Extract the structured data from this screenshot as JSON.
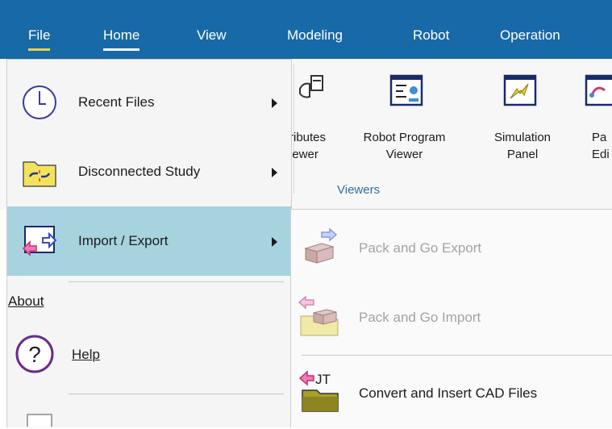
{
  "tabs": [
    {
      "label": "File"
    },
    {
      "label": "Home"
    },
    {
      "label": "View"
    },
    {
      "label": "Modeling"
    },
    {
      "label": "Robot"
    },
    {
      "label": "Operation"
    }
  ],
  "ribbon": {
    "viewers_group": "Viewers",
    "buttons": [
      {
        "line1": "ributes",
        "line2": "iewer",
        "icon": "attributes-viewer-icon"
      },
      {
        "line1": "Robot Program",
        "line2": "Viewer",
        "icon": "robot-program-viewer-icon"
      },
      {
        "line1": "Simulation",
        "line2": "Panel",
        "icon": "simulation-panel-icon"
      },
      {
        "line1": "Pa",
        "line2": "Edi",
        "icon": "path-editor-icon"
      }
    ]
  },
  "file_menu": {
    "items": [
      {
        "label": "Recent Files",
        "icon": "clock-icon",
        "has_submenu": true
      },
      {
        "label": "Disconnected Study",
        "icon": "disconnected-folder-icon",
        "has_submenu": true
      },
      {
        "label": "Import / Export",
        "icon": "import-export-icon",
        "has_submenu": true,
        "selected": true
      }
    ],
    "about_heading": "About",
    "help_label": "Help",
    "help_icon": "help-question-icon"
  },
  "submenu": {
    "items": [
      {
        "label": "Pack and Go Export",
        "icon": "pack-export-icon",
        "enabled": false
      },
      {
        "label": "Pack and Go Import",
        "icon": "pack-import-icon",
        "enabled": false
      },
      {
        "label": "Convert and Insert CAD Files",
        "icon": "jt-convert-icon",
        "enabled": true
      }
    ]
  },
  "colors": {
    "tabbar": "#1769a8",
    "selected_item": "#a7d3df",
    "group_label": "#2b6ea6",
    "disabled_text": "#a3a3a3"
  }
}
